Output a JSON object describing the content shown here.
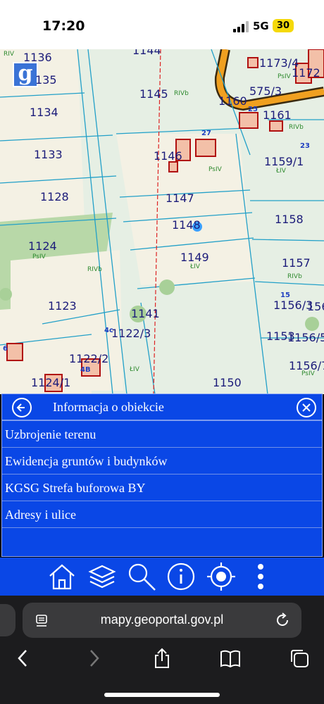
{
  "status": {
    "time": "17:20",
    "network": "5G",
    "battery": "30"
  },
  "map": {
    "parcels": [
      "1136",
      "135",
      "1134",
      "1133",
      "1128",
      "1124",
      "1123",
      "1145",
      "1146",
      "1147",
      "1148",
      "1149",
      "1141",
      "1122/3",
      "1122/2",
      "1124/1",
      "1150",
      "1160",
      "1161",
      "1159/1",
      "1158",
      "1157",
      "1156/3",
      "156",
      "1153",
      "1156/5",
      "1156/7",
      "1173/4",
      "1172",
      "575/3",
      "1144"
    ],
    "land_classes": [
      "RIV",
      "RIVb",
      "RIVb",
      "PsIV",
      "ŁIV",
      "PsIV",
      "RIVb",
      "ŁIV",
      "ŁIV",
      "RIVb",
      "PsIV",
      "PsIV"
    ],
    "address_numbers": [
      "27",
      "25",
      "23",
      "15",
      "4c",
      "4B",
      "6"
    ]
  },
  "panel": {
    "title": "Informacja o obiekcie",
    "items": [
      "Uzbrojenie terenu",
      "Ewidencja gruntów i budynków",
      "KGSG Strefa buforowa BY",
      "Adresy i ulice"
    ]
  },
  "browser": {
    "url": "mapy.geoportal.gov.pl"
  },
  "colors": {
    "panel_bg": "#0a47e6",
    "map_bg": "#e6efe4",
    "parcel_line": "#22a0c8",
    "road": "#e08a00"
  }
}
